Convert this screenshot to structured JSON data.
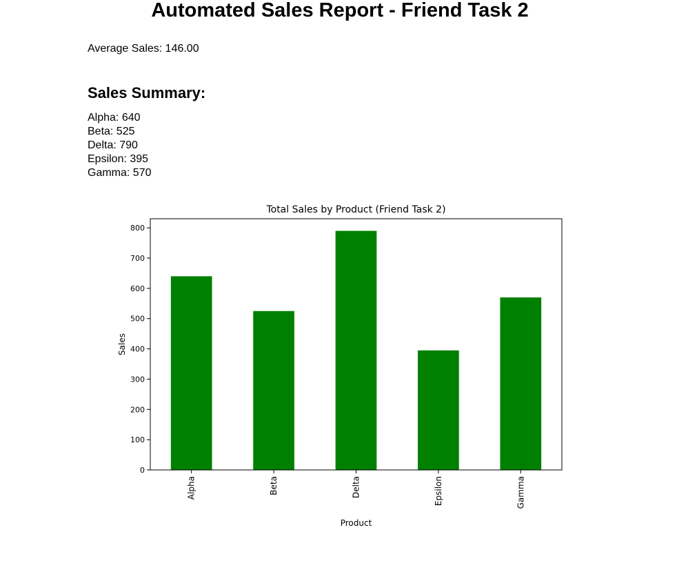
{
  "report": {
    "title": "Automated Sales Report - Friend Task 2",
    "average_label": "Average Sales: 146.00",
    "summary_heading": "Sales Summary:",
    "summary_items": [
      "Alpha: 640",
      "Beta: 525",
      "Delta: 790",
      "Epsilon: 395",
      "Gamma: 570"
    ]
  },
  "chart_data": {
    "type": "bar",
    "title": "Total Sales by Product (Friend Task 2)",
    "xlabel": "Product",
    "ylabel": "Sales",
    "categories": [
      "Alpha",
      "Beta",
      "Delta",
      "Epsilon",
      "Gamma"
    ],
    "values": [
      640,
      525,
      790,
      395,
      570
    ],
    "ylim": [
      0,
      830
    ],
    "yticks": [
      0,
      100,
      200,
      300,
      400,
      500,
      600,
      700,
      800
    ],
    "bar_color": "#008000",
    "grid": false,
    "legend": "none"
  }
}
